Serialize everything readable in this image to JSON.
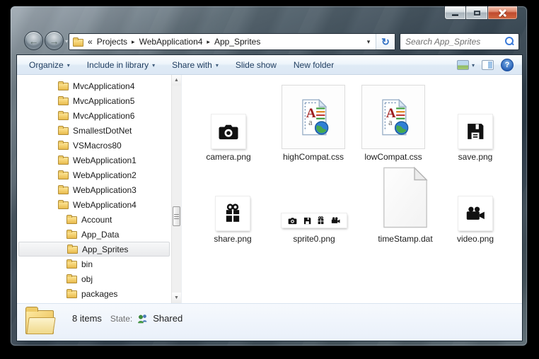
{
  "window": {
    "caption_buttons": [
      "minimize",
      "maximize",
      "close"
    ]
  },
  "nav": {
    "breadcrumb": {
      "overflow_chevron": "«",
      "separator": "▸",
      "segments": [
        "Projects",
        "WebApplication4",
        "App_Sprites"
      ],
      "dropdown_glyph": "▾"
    },
    "refresh_glyph": "↻",
    "search": {
      "placeholder": "Search App_Sprites"
    }
  },
  "toolbar": {
    "dropdown_glyph": "▾",
    "items": [
      {
        "label": "Organize",
        "dropdown": true
      },
      {
        "label": "Include in library",
        "dropdown": true
      },
      {
        "label": "Share with",
        "dropdown": true
      },
      {
        "label": "Slide show",
        "dropdown": false
      },
      {
        "label": "New folder",
        "dropdown": false
      }
    ]
  },
  "sidebar": {
    "scroll_up_glyph": "▲",
    "scroll_down_glyph": "▼",
    "items": [
      {
        "label": "MvcApplication4",
        "level": 1
      },
      {
        "label": "MvcApplication5",
        "level": 1
      },
      {
        "label": "MvcApplication6",
        "level": 1
      },
      {
        "label": "SmallestDotNet",
        "level": 1
      },
      {
        "label": "VSMacros80",
        "level": 1
      },
      {
        "label": "WebApplication1",
        "level": 1
      },
      {
        "label": "WebApplication2",
        "level": 1
      },
      {
        "label": "WebApplication3",
        "level": 1
      },
      {
        "label": "WebApplication4",
        "level": 1,
        "expanded": true
      },
      {
        "label": "Account",
        "level": 2
      },
      {
        "label": "App_Data",
        "level": 2
      },
      {
        "label": "App_Sprites",
        "level": 2,
        "selected": true
      },
      {
        "label": "bin",
        "level": 2
      },
      {
        "label": "obj",
        "level": 2
      },
      {
        "label": "packages",
        "level": 2
      },
      {
        "label": "",
        "level": 1
      }
    ]
  },
  "files": [
    {
      "name": "camera.png",
      "icon": "camera-icon"
    },
    {
      "name": "highCompat.css",
      "icon": "css-document-icon"
    },
    {
      "name": "lowCompat.css",
      "icon": "css-document-icon"
    },
    {
      "name": "save.png",
      "icon": "save-icon"
    },
    {
      "name": "share.png",
      "icon": "share-icon"
    },
    {
      "name": "sprite0.png",
      "icon": "sprite-strip-icon"
    },
    {
      "name": "timeStamp.dat",
      "icon": "generic-document-icon"
    },
    {
      "name": "video.png",
      "icon": "video-icon"
    }
  ],
  "statusbar": {
    "items_count": "8 items",
    "state_label": "State:",
    "state_value": "Shared"
  },
  "colors": {
    "close_button": "#c04a2e",
    "toolbar_text": "#1e3c5f",
    "glass_dark": "#283644",
    "folder_yellow": "#f3cf6d",
    "details_pane": "#edf3fb"
  }
}
